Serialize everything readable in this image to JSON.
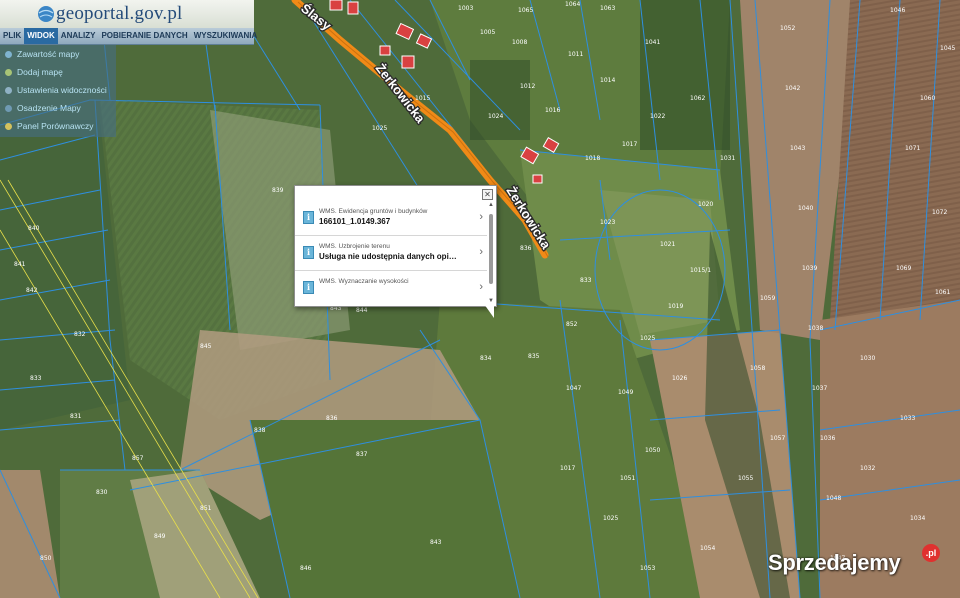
{
  "app": {
    "logo_text": "geoportal.gov.pl",
    "menu": [
      "PLIK",
      "WIDOK",
      "ANALIZY",
      "POBIERANIE DANYCH",
      "WYSZUKIWANIA"
    ],
    "active_menu": "WIDOK",
    "view_menu_items": [
      "Zawartość mapy",
      "Dodaj mapę",
      "Ustawienia widoczności",
      "Osadzenie Mapy",
      "Panel Porównawczy"
    ]
  },
  "map": {
    "streets": [
      "Ślasy",
      "Żerkowicka",
      "Żerkowicka"
    ],
    "road_color": "#f08a17",
    "parcel_line_color": "#2e8fe0",
    "parcel_labels": [
      "1005",
      "1008",
      "1003",
      "1041",
      "1011",
      "1012",
      "1014",
      "1015",
      "1024",
      "1025",
      "1016",
      "1017",
      "1018",
      "1022",
      "1023",
      "1021",
      "1015/1",
      "1019",
      "1020",
      "1025",
      "1026",
      "1049",
      "1050",
      "1051",
      "1052",
      "1042",
      "1043",
      "1040",
      "1039",
      "1038",
      "1037",
      "1036",
      "1048",
      "1047",
      "1046",
      "1045",
      "1060",
      "1071",
      "1072",
      "1069",
      "1061",
      "1030",
      "1033",
      "1032",
      "1034",
      "839",
      "840",
      "841",
      "842",
      "843",
      "844",
      "845",
      "836",
      "837",
      "838",
      "857",
      "830",
      "831",
      "832",
      "833",
      "834",
      "835",
      "852",
      "833",
      "836",
      "843",
      "846",
      "849",
      "850",
      "851",
      "1047",
      "1017",
      "1025",
      "1053",
      "1054",
      "1055",
      "1057",
      "1058",
      "1059",
      "1031",
      "1062",
      "1063",
      "1064",
      "1065"
    ]
  },
  "popup": {
    "rows": [
      {
        "title": "WMS. Ewidencja gruntów i budynków",
        "value": "166101_1.0149.367"
      },
      {
        "title": "WMS. Uzbrojenie terenu",
        "value": "Usługa nie udostępnia danych opi…"
      },
      {
        "title": "WMS. Wyznaczanie wysokości",
        "value": ""
      }
    ]
  },
  "watermark": {
    "text": "Sprzedajemy",
    "badge": ".pl"
  }
}
